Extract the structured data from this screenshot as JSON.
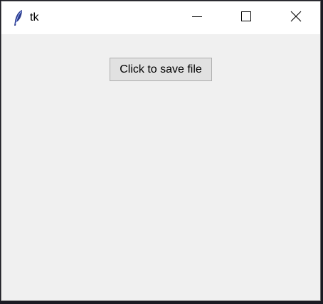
{
  "window": {
    "title": "tk",
    "app_icon": "feather-icon",
    "controls": {
      "minimize_icon": "minimize-icon",
      "maximize_icon": "maximize-icon",
      "close_icon": "close-icon"
    }
  },
  "main": {
    "save_button_label": "Click to save file"
  },
  "colors": {
    "client_background": "#f0f0f0",
    "titlebar_background": "#ffffff",
    "button_face": "#e1e1e1",
    "button_border": "#adadad"
  }
}
